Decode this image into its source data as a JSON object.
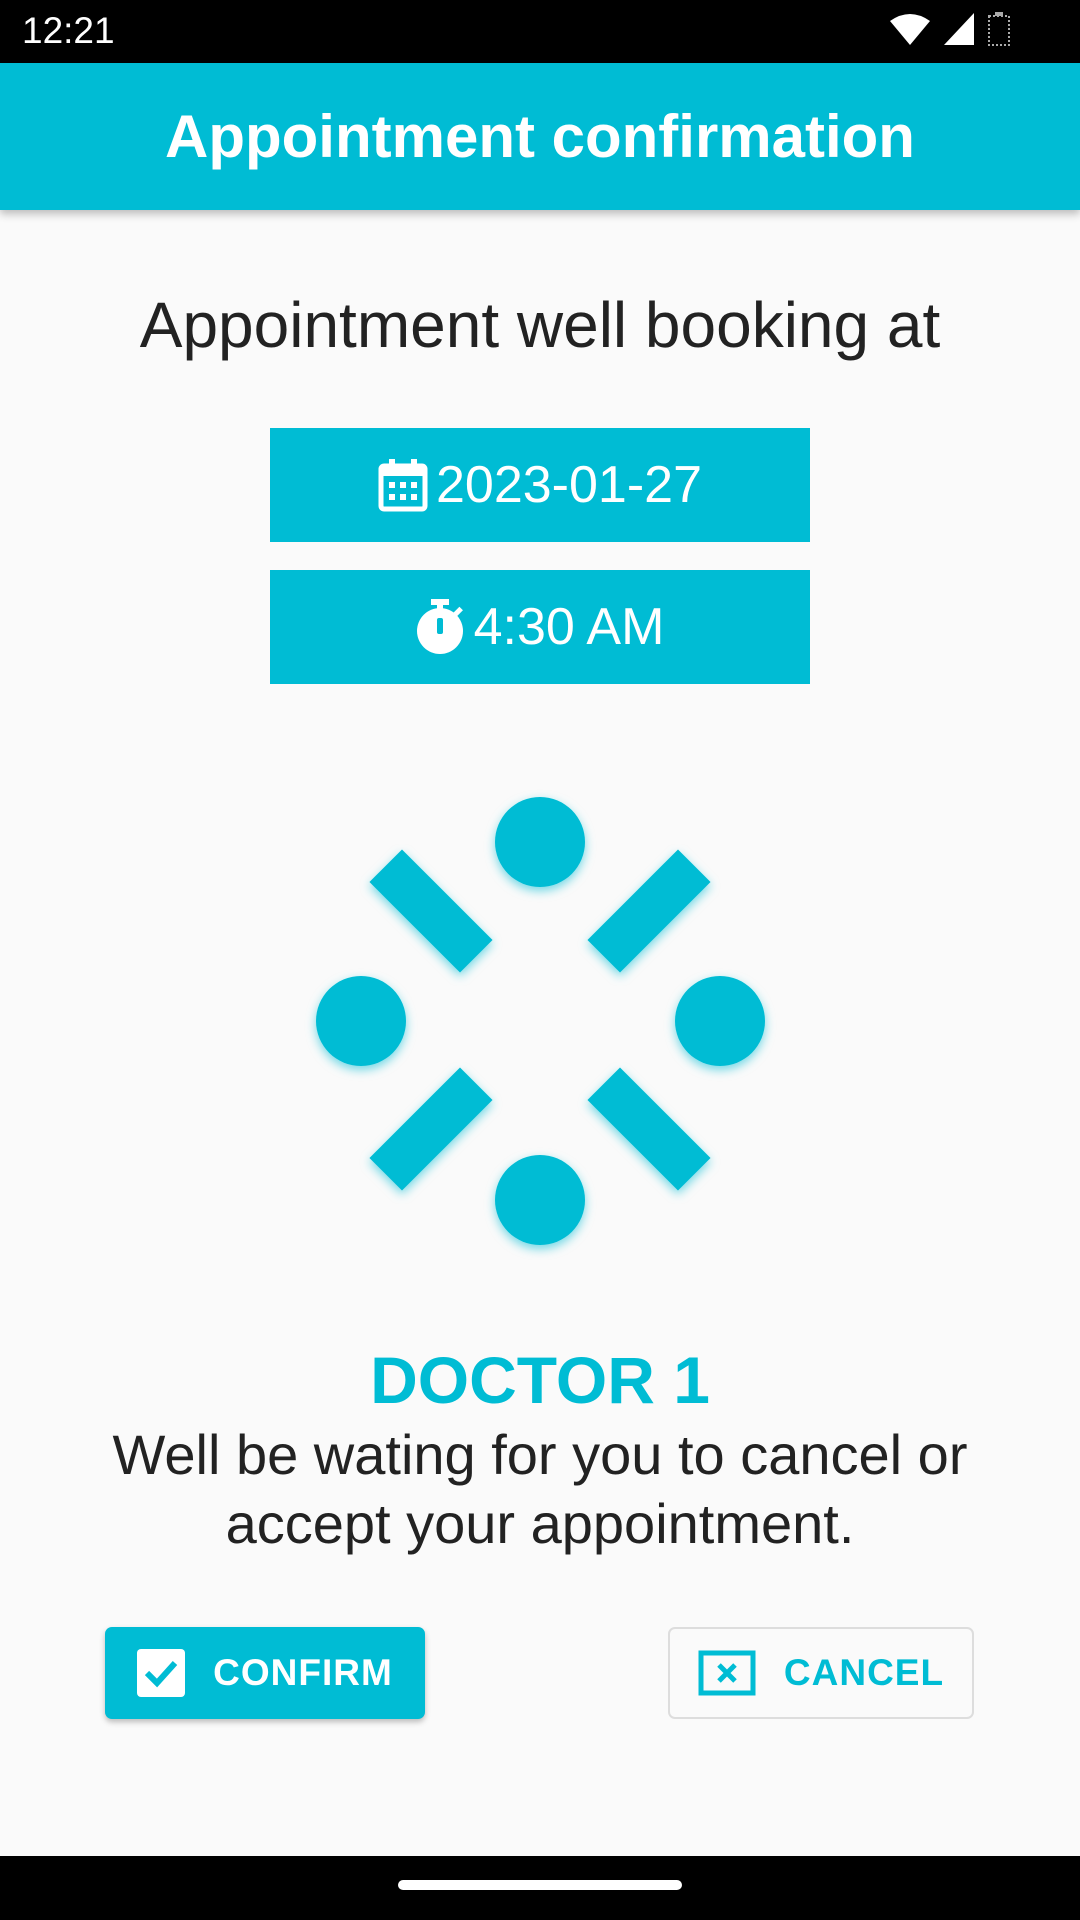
{
  "status_bar": {
    "time": "12:21"
  },
  "app_bar": {
    "title": "Appointment confirmation"
  },
  "subtitle": "Appointment well booking at",
  "date": {
    "value": "2023-01-27",
    "icon": "calendar-icon"
  },
  "time": {
    "value": "4:30 AM",
    "icon": "stopwatch-icon"
  },
  "doctor": {
    "name": "DOCTOR 1"
  },
  "message": "Well be wating for you to cancel or accept your appointment.",
  "buttons": {
    "confirm": "CONFIRM",
    "cancel": "CANCEL"
  },
  "colors": {
    "accent": "#00bcd4",
    "background": "#fafafa"
  }
}
